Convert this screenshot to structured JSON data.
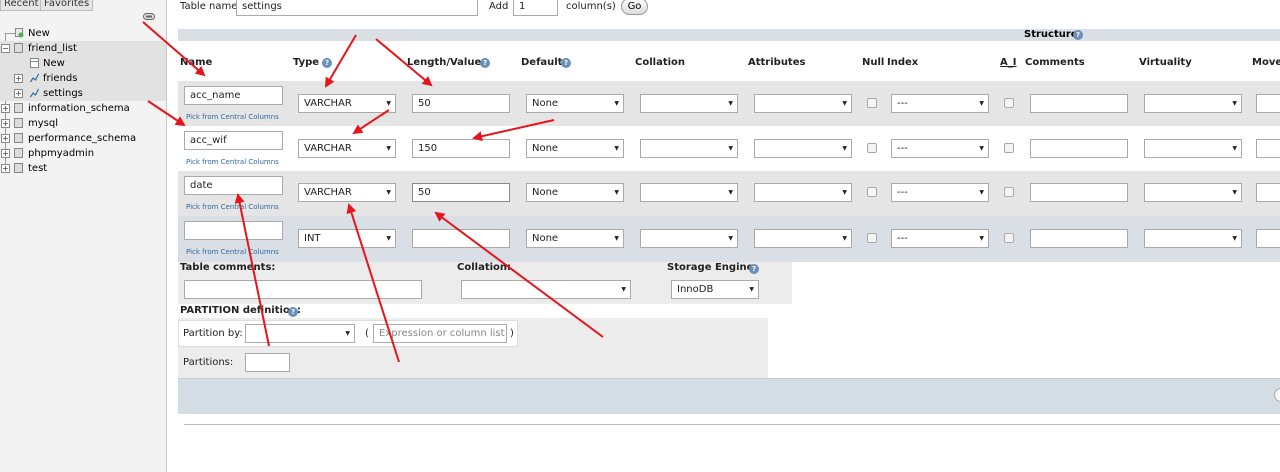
{
  "sidebar": {
    "tabs": [
      "Recent",
      "Favorites"
    ],
    "tree": {
      "new_root": "New",
      "db_friend_list": "friend_list",
      "new_table": "New",
      "table_friends": "friends",
      "table_settings": "settings",
      "db_information_schema": "information_schema",
      "db_mysql": "mysql",
      "db_performance_schema": "performance_schema",
      "db_phpmyadmin": "phpmyadmin",
      "db_test": "test"
    }
  },
  "top_form": {
    "table_name_label": "Table name:",
    "table_name_value": "settings",
    "add_label": "Add",
    "add_value": "1",
    "columns_label": "column(s)",
    "go_label": "Go"
  },
  "structure": {
    "title": "Structure",
    "headers": {
      "name": "Name",
      "type": "Type",
      "length": "Length/Values",
      "default": "Default",
      "collation": "Collation",
      "attributes": "Attributes",
      "null": "Null",
      "index": "Index",
      "ai": "A_I",
      "comments": "Comments",
      "virtuality": "Virtuality",
      "move": "Move"
    },
    "pick_label": "Pick from Central Columns",
    "rows": [
      {
        "name": "acc_name",
        "type": "VARCHAR",
        "length": "50",
        "default": "None",
        "index": "---"
      },
      {
        "name": "acc_wif",
        "type": "VARCHAR",
        "length": "150",
        "default": "None",
        "index": "---"
      },
      {
        "name": "date",
        "type": "VARCHAR",
        "length": "50",
        "default": "None",
        "index": "---"
      },
      {
        "name": "",
        "type": "INT",
        "length": "",
        "default": "None",
        "index": "---"
      }
    ]
  },
  "bottom": {
    "table_comments_label": "Table comments:",
    "collation_label": "Collation:",
    "storage_engine_label": "Storage Engine:",
    "storage_engine_value": "InnoDB",
    "partition_label": "PARTITION definition:",
    "partition_by_label": "Partition by:",
    "paren_open": "(",
    "paren_close": ")",
    "expression_placeholder": "Expression or column list",
    "partitions_label": "Partitions:"
  },
  "colors": {
    "annotation_arrow": "#e8141b",
    "header_band": "#d9dfe5",
    "row_shade": "#e5e5e5",
    "footer_band": "#d5dde4"
  }
}
